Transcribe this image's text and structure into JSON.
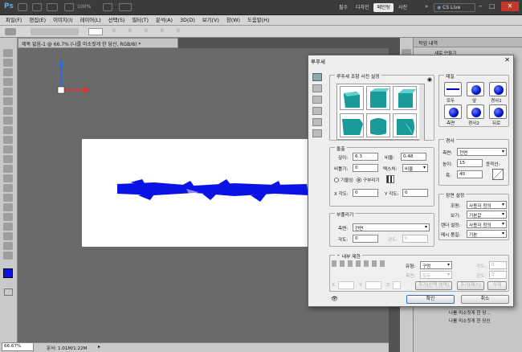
{
  "app": {
    "logo": "Ps",
    "zoom": "100%",
    "workspaces": [
      "필수",
      "디자인",
      "페인팅",
      "사진"
    ],
    "active_workspace": "페인팅",
    "cs_live": "CS Live",
    "search_icon": "search-icon"
  },
  "menu": [
    "파일(F)",
    "편집(E)",
    "이미지(I)",
    "레이어(L)",
    "선택(S)",
    "필터(T)",
    "분석(A)",
    "3D(D)",
    "보기(V)",
    "창(W)",
    "도움말(H)"
  ],
  "options_bar": {
    "values": [
      "0",
      "0",
      "0",
      "0",
      "0"
    ]
  },
  "document": {
    "tab_title": "제목 없음-1 @ 66.7% (나를 미소짓게 한 당신, RGB/8) *",
    "status_zoom": "66.67%",
    "status_doc": "문서: 1.01M/1.22M"
  },
  "panel": {
    "tab": "작업 내역",
    "item": "새로 만들기",
    "layers": [
      "효과",
      "나를 미소짓게 한 당...",
      "나를 미소짓게 한 당신"
    ]
  },
  "dialog": {
    "title": "루푸세",
    "preset_label": "루푸세 조항 사전 설정",
    "material_label": "재질",
    "materials_top": [
      "모두",
      "앞",
      "경사1"
    ],
    "materials_bottom": [
      "측면",
      "경사2",
      "뒤로"
    ],
    "extrude": {
      "label": "돌출",
      "depth_label": "깊이:",
      "depth": "6.3",
      "scale_label": "비율:",
      "scale": "0.48",
      "bend_label": "비틀기:",
      "bend": "0",
      "texture_label": "텍스처:",
      "texture": "비율",
      "bend_check": "기울임",
      "radio_label": "구부리기",
      "x_angle_label": "X 각도:",
      "x_angle": "0",
      "y_angle_label": "Y 각도:",
      "y_angle": "0"
    },
    "inflate": {
      "label": "부풀리기",
      "side_label": "측면:",
      "side": "전면",
      "angle_label": "각도:",
      "angle": "0",
      "strength_label": "강도:",
      "strength": "0"
    },
    "bevel": {
      "label": "경사",
      "side_label": "측면:",
      "side": "전면",
      "height_label": "높이:",
      "height": "15",
      "contour_label": "윤곽선:",
      "width_label": "폭:",
      "width": "40"
    },
    "scene": {
      "label": "장면 설정",
      "light_label": "조명:",
      "light": "사용자 정의",
      "view_label": "보기:",
      "view": "기본값",
      "render_label": "렌더 설정:",
      "render": "사용자 정의",
      "mesh_label": "메시 품질:",
      "mesh": "기본"
    },
    "internal": {
      "label": "내부 제한",
      "type_label": "유형:",
      "type": "구멍",
      "side_label": "측면:",
      "side": "모두",
      "angle_label": "각도:",
      "angle": "0",
      "strength_label": "강도:",
      "strength": "0",
      "btn_add": "추가(선택 영역)",
      "btn_add2": "추가(패스)",
      "btn_delete": "삭제",
      "x_label": "X:",
      "y_label": "Y:",
      "z_label": "Z:"
    },
    "ok": "확인",
    "cancel": "취소"
  },
  "colors": {
    "foreground": "#0a12e6",
    "background": "#ffffff",
    "accent": "#0000ff"
  }
}
